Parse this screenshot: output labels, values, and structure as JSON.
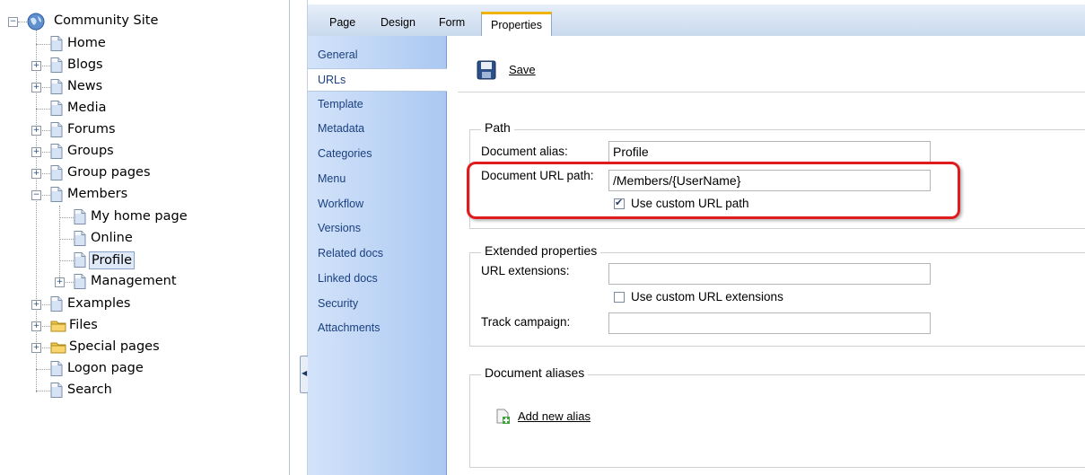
{
  "tree": {
    "root": "Community Site",
    "items": [
      {
        "label": "Home"
      },
      {
        "label": "Blogs"
      },
      {
        "label": "News"
      },
      {
        "label": "Media"
      },
      {
        "label": "Forums"
      },
      {
        "label": "Groups"
      },
      {
        "label": "Group pages"
      },
      {
        "label": "Members"
      },
      {
        "label": "My home page"
      },
      {
        "label": "Online"
      },
      {
        "label": "Profile"
      },
      {
        "label": "Management"
      },
      {
        "label": "Examples"
      },
      {
        "label": "Files"
      },
      {
        "label": "Special pages"
      },
      {
        "label": "Logon page"
      },
      {
        "label": "Search"
      }
    ],
    "selected": "Profile"
  },
  "tabs": [
    "Page",
    "Design",
    "Form",
    "Properties"
  ],
  "active_tab": "Properties",
  "menu": [
    "General",
    "URLs",
    "Template",
    "Metadata",
    "Categories",
    "Menu",
    "Workflow",
    "Versions",
    "Related docs",
    "Linked docs",
    "Security",
    "Attachments"
  ],
  "active_menu": "URLs",
  "toolbar": {
    "save_label": "Save"
  },
  "path_section": {
    "legend": "Path",
    "alias_label": "Document alias:",
    "alias_value": "Profile",
    "url_path_label": "Document URL path:",
    "url_path_value": "/Members/{UserName}",
    "custom_url_label": "Use custom URL path",
    "custom_url_checked": true
  },
  "extended_section": {
    "legend": "Extended properties",
    "url_ext_label": "URL extensions:",
    "url_ext_value": "",
    "custom_ext_label": "Use custom URL extensions",
    "custom_ext_checked": false,
    "track_label": "Track campaign:",
    "track_value": ""
  },
  "aliases_section": {
    "legend": "Document aliases",
    "add_label": "Add new alias"
  },
  "colors": {
    "highlight": "#e01b1b",
    "active_tab_top": "#f0b400",
    "menu_text": "#1a3f7f"
  }
}
